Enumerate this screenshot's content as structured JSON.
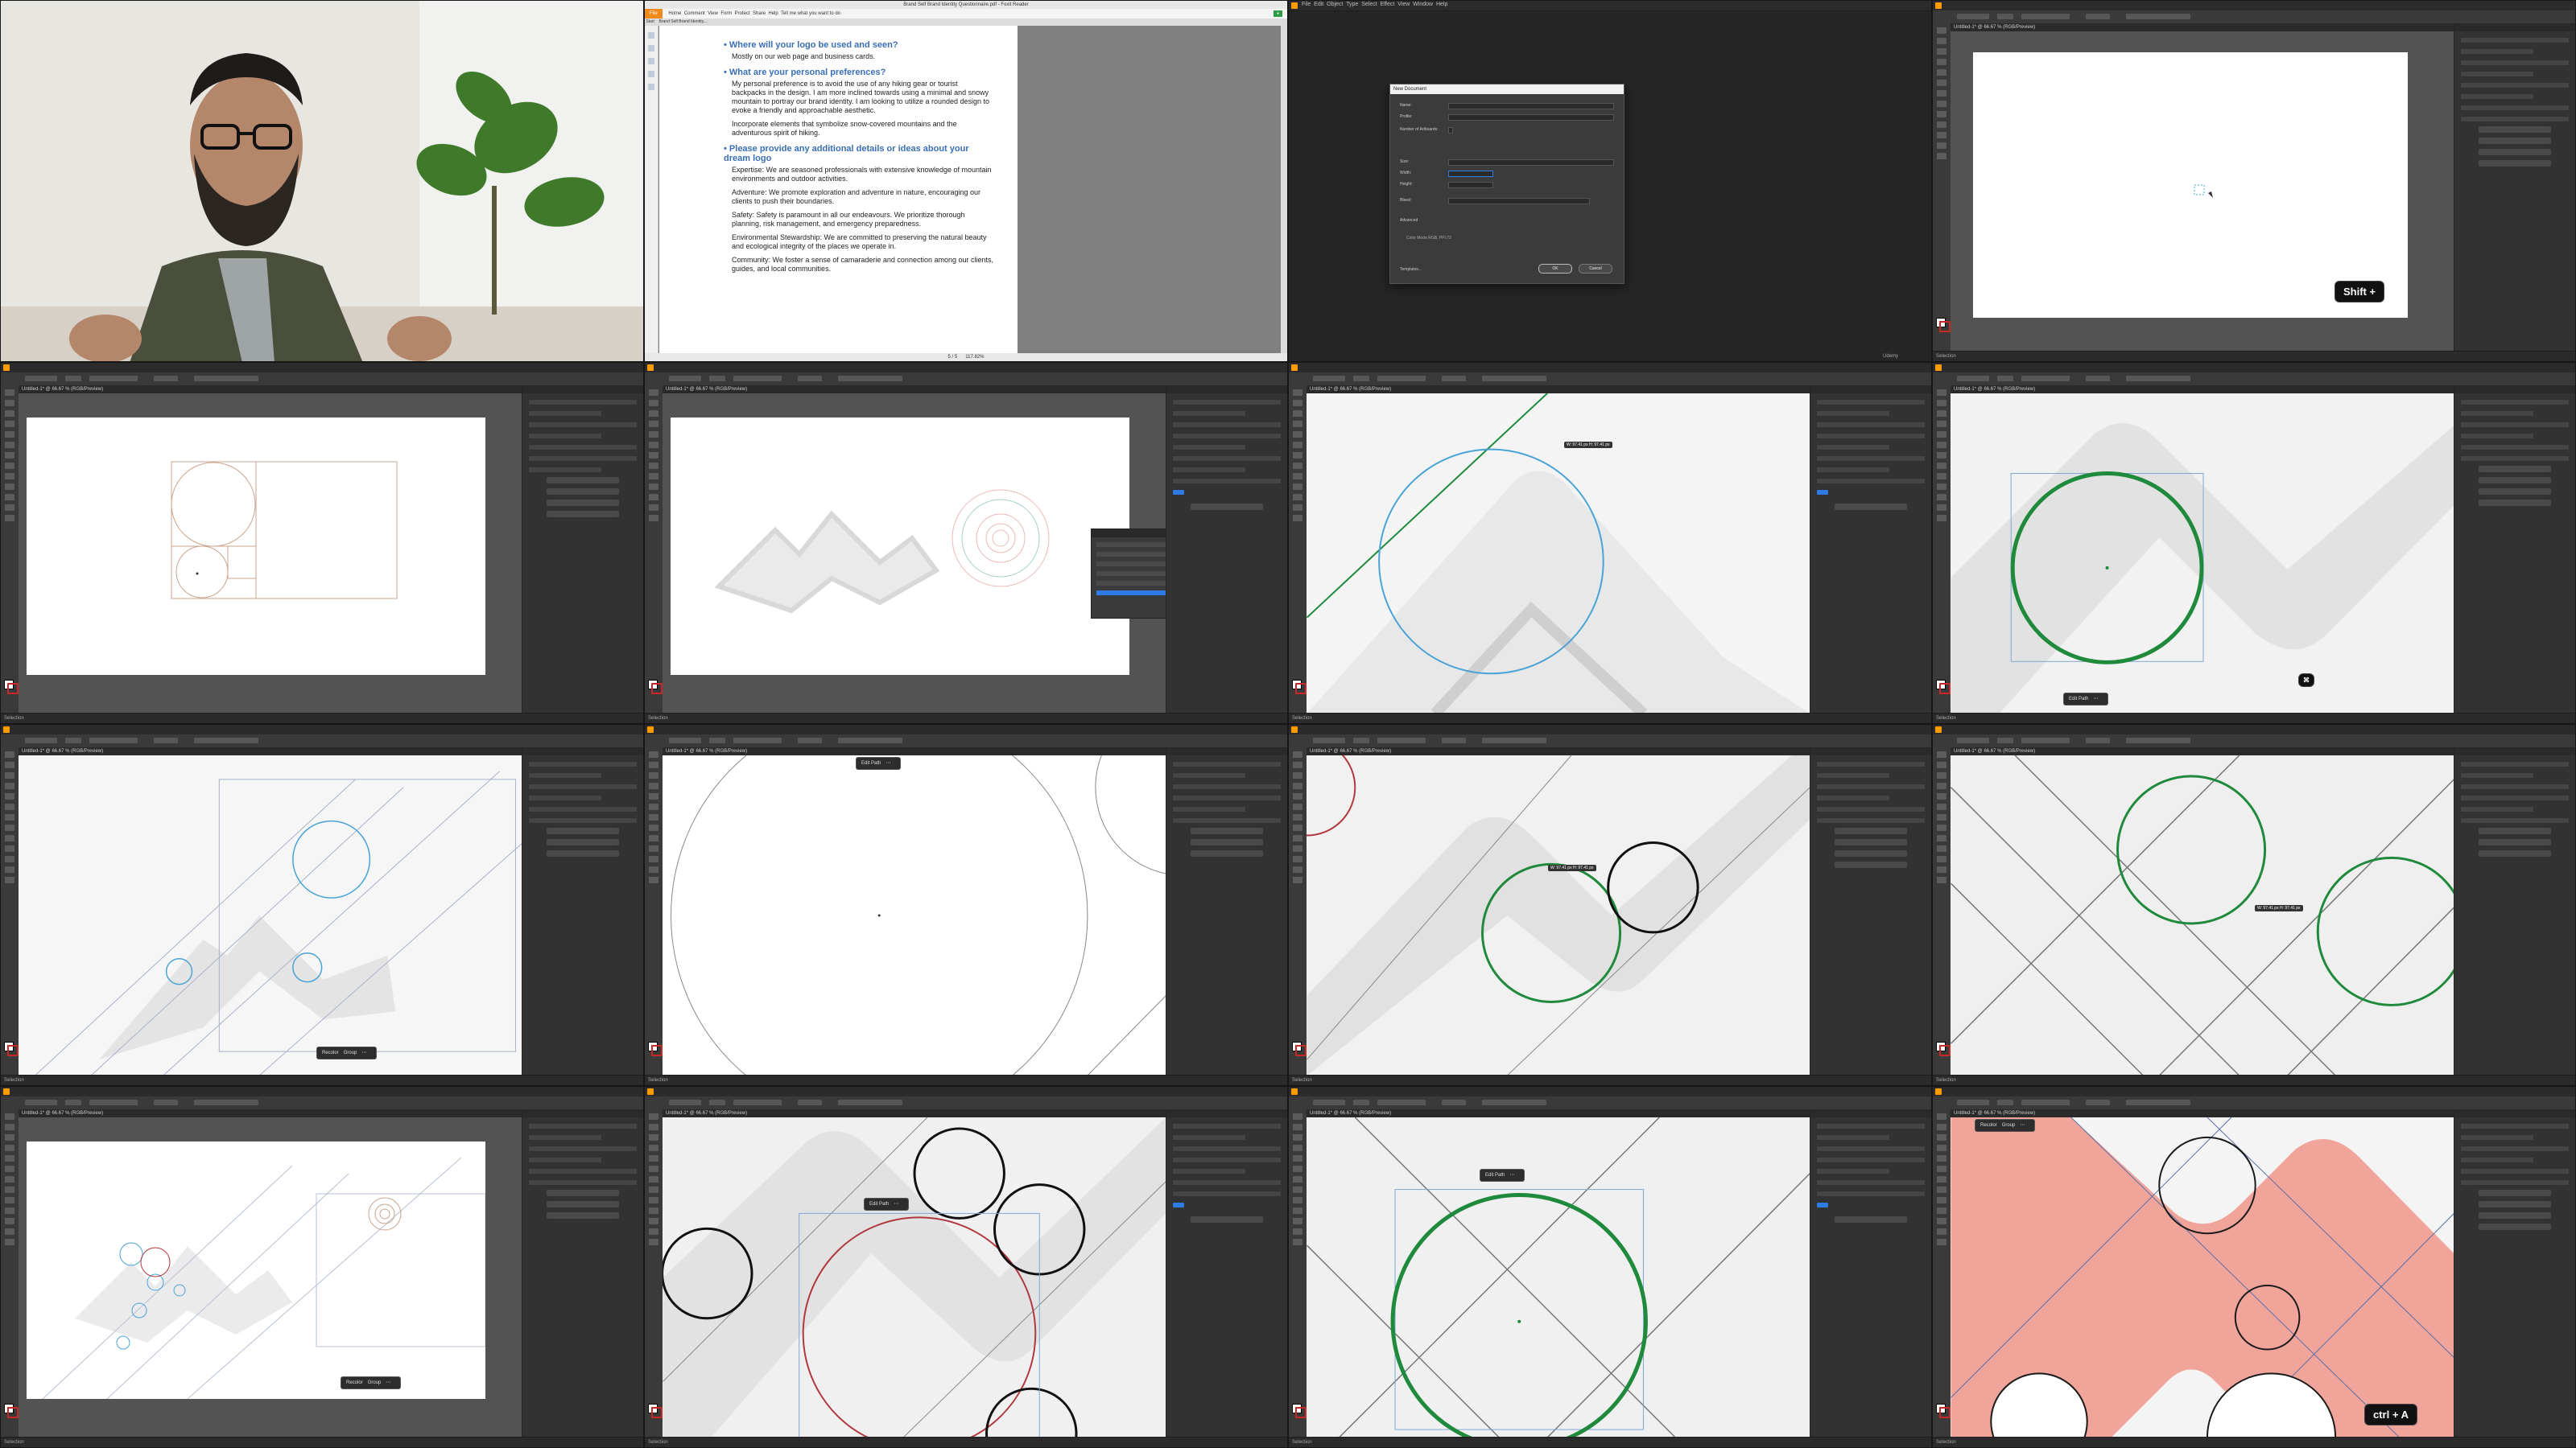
{
  "video": {
    "subject": "instructor-presenter"
  },
  "pdf": {
    "window_title": "Brand Self Brand Identity Questionnaire.pdf - Foxit Reader",
    "menu": [
      "File",
      "Home",
      "Comment",
      "View",
      "Form",
      "Protect",
      "Share",
      "Help",
      "Tell me what you want to do"
    ],
    "tabs": [
      "Start",
      "Brand Self Brand Identity..."
    ],
    "sections": [
      {
        "heading": "Where will your logo be used and seen?",
        "paragraphs": [
          "Mostly on our web page and business cards."
        ]
      },
      {
        "heading": "What are your personal preferences?",
        "paragraphs": [
          "My personal preference is to avoid the use of any hiking gear or tourist backpacks in the design. I am more inclined towards using a minimal and snowy mountain to portray our brand identity. I am looking to utilize a rounded design to evoke a friendly and approachable aesthetic.",
          "Incorporate elements that symbolize snow-covered mountains and the adventurous spirit of hiking."
        ]
      },
      {
        "heading": "Please provide any additional details or ideas about your dream logo",
        "paragraphs": [
          "Expertise: We are seasoned professionals with extensive knowledge of mountain environments and outdoor activities.",
          "Adventure: We promote exploration and adventure in nature, encouraging our clients to push their boundaries.",
          "Safety: Safety is paramount in all our endeavours. We prioritize thorough planning, risk management, and emergency preparedness.",
          "Environmental Stewardship: We are committed to preserving the natural beauty and ecological integrity of the places we operate in.",
          "Community: We foster a sense of camaraderie and connection among our clients, guides, and local communities."
        ]
      }
    ],
    "page_indicator": "5 / 5",
    "zoom": "117.82%"
  },
  "illustrator": {
    "menu": [
      "File",
      "Edit",
      "Object",
      "Type",
      "Select",
      "Effect",
      "View",
      "Window",
      "Help"
    ],
    "doc_tab": "Untitled-1* @ 66.67 % (RGB/Preview)",
    "status": "Selection",
    "udemy": "Udemy",
    "panel_title": "Properties",
    "quick_actions": [
      "Offset Path",
      "Expand Shape",
      "Arrange",
      "Align to Pixel Grid",
      "Recolor",
      "Start Global Edit"
    ]
  },
  "dialog": {
    "title": "New Document",
    "fields": [
      {
        "label": "Name:",
        "value": "Untitled-1"
      },
      {
        "label": "Profile:",
        "value": "[Custom]"
      },
      {
        "label": "Number of Artboards:",
        "value": "1"
      },
      {
        "label": "Size:",
        "value": "[Custom]"
      },
      {
        "label": "Width:",
        "value": "900 px"
      },
      {
        "label": "Height:",
        "value": "900 px"
      },
      {
        "label": "Bleed:",
        "value": "0 px"
      }
    ],
    "advanced": "Advanced",
    "color_mode": "Color Mode:RGB, PPI:72",
    "templates": "Templates...",
    "ok": "OK",
    "cancel": "Cancel"
  },
  "context_bar": {
    "items": [
      "Edit Path",
      "Recolor",
      "Group"
    ]
  },
  "shortcuts": {
    "shift": "Shift +",
    "ctrl_a": "ctrl + A"
  },
  "smart_guide": {
    "coords": "W: 97.41 px  H: 97.41 px"
  },
  "colors": {
    "green_circle": "#1f8a3c",
    "blue_guide": "#4aa3d6",
    "red_circle": "#b0383e",
    "salmon_fill": "#f0a49a",
    "pdf_heading": "#3a6fb5"
  }
}
